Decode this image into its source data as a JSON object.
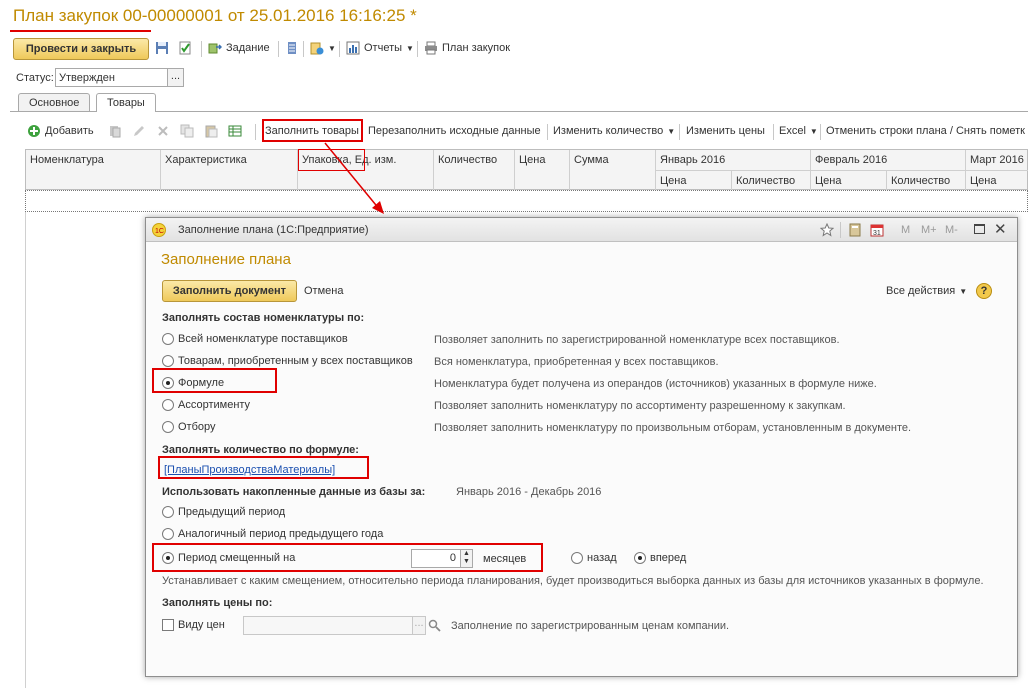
{
  "window": {
    "title": "План закупок 00-00000001 от 25.01.2016 16:16:25 *"
  },
  "toolbar": {
    "post_close": "Провести и закрыть",
    "task": "Задание",
    "reports": "Отчеты",
    "plan": "План закупок"
  },
  "status": {
    "label": "Статус:",
    "value": "Утвержден",
    "choose": "..."
  },
  "tabs": [
    {
      "label": "Основное"
    },
    {
      "label": "Товары"
    }
  ],
  "goods_toolbar": {
    "add": "Добавить",
    "fill": "Заполнить товары",
    "refill": "Перезаполнить исходные данные",
    "change_qty": "Изменить количество",
    "change_prices": "Изменить цены",
    "excel": "Excel",
    "cancel_rows": "Отменить строки плана / Снять пометк"
  },
  "grid": {
    "columns": [
      "Номенклатура",
      "Характеристика",
      "Упаковка, Ед. изм.",
      "Количество",
      "Цена",
      "Сумма"
    ],
    "months": [
      "Январь 2016",
      "Февраль 2016",
      "Март 2016"
    ],
    "sub_price": "Цена",
    "sub_qty": "Количество"
  },
  "dialog": {
    "window_title": "Заполнение плана  (1С:Предприятие)",
    "heading": "Заполнение плана",
    "fill_doc": "Заполнить документ",
    "cancel": "Отмена",
    "all_actions": "Все действия",
    "help": "?",
    "section_nomen": "Заполнять состав номенклатуры по:",
    "options": [
      {
        "label": "Всей номенклатуре поставщиков",
        "desc": "Позволяет заполнить по зарегистрированной номенклатуре всех поставщиков."
      },
      {
        "label": "Товарам, приобретенным у всех поставщиков",
        "desc": "Вся номенклатура, приобретенная у всех поставщиков."
      },
      {
        "label": "Формуле",
        "desc": "Номенклатура будет получена из операндов (источников) указанных в формуле ниже."
      },
      {
        "label": "Ассортименту",
        "desc": "Позволяет заполнить номенклатуру по ассортименту разрешенному к закупкам."
      },
      {
        "label": "Отбору",
        "desc": "Позволяет заполнить номенклатуру по произвольным отборам, установленным в документе."
      }
    ],
    "section_qty": "Заполнять количество по формуле:",
    "formula": "[ПланыПроизводстваМатериалы]",
    "section_hist": "Использовать накопленные данные из базы за:",
    "hist_period": "Январь 2016 - Декабрь 2016",
    "prev_period": "Предыдущий период",
    "same_period": "Аналогичный период предыдущего года",
    "shift_period": "Период смещенный на",
    "shift_value": "0",
    "months_label": "месяцев",
    "back": "назад",
    "forward": "вперед",
    "shift_desc": "Устанавливает с каким смещением, относительно периода планирования, будет производиться выборка данных из базы для источников указанных в формуле.",
    "section_prices": "Заполнять цены по:",
    "price_type": "Виду цен",
    "price_desc": "Заполнение по зарегистрированным ценам компании.",
    "mini": {
      "m": "M",
      "mplus": "M+",
      "mminus": "M-"
    }
  },
  "colors": {
    "accent": "#c08a00",
    "highlight": "#e00000",
    "button": "#efc95a"
  }
}
